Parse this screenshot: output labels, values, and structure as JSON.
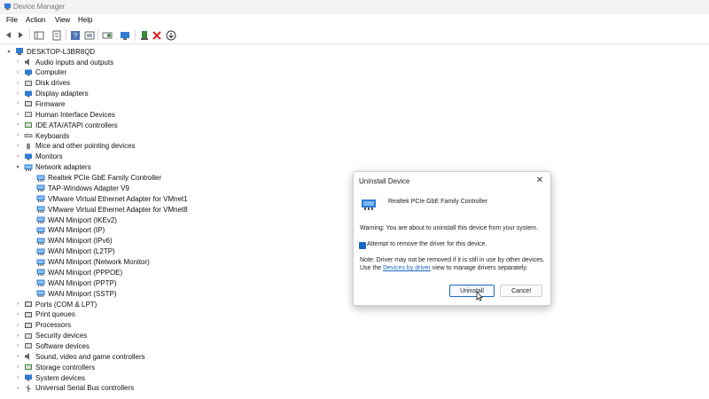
{
  "window": {
    "title": "Device Manager",
    "icon": "device-manager-icon"
  },
  "menu": [
    "File",
    "Action",
    "View",
    "Help"
  ],
  "toolbar": [
    "back-icon",
    "forward-icon",
    "show-hide-tree-icon",
    "properties-icon",
    "help-icon",
    "view-resources-icon",
    "scan-hardware-icon",
    "update-driver-icon",
    "add-legacy-icon",
    "disable-device-icon",
    "uninstall-device-icon",
    "download-icon"
  ],
  "tree": {
    "root": {
      "label": "DESKTOP-L3BR8QD",
      "icon": "computer-icon",
      "expanded": true
    },
    "categories": [
      {
        "label": "Audio inputs and outputs",
        "icon": "speaker-icon",
        "color": "#555555"
      },
      {
        "label": "Computer",
        "icon": "monitor-icon",
        "color": "#2f7bd6"
      },
      {
        "label": "Disk drives",
        "icon": "disk-drive-icon",
        "color": "#666666"
      },
      {
        "label": "Display adapters",
        "icon": "display-adapter-icon",
        "color": "#2f7bd6"
      },
      {
        "label": "Firmware",
        "icon": "firmware-icon",
        "color": "#555555"
      },
      {
        "label": "Human Interface Devices",
        "icon": "hid-icon",
        "color": "#777777"
      },
      {
        "label": "IDE ATA/ATAPI controllers",
        "icon": "ide-controller-icon",
        "color": "#3a8a3a"
      },
      {
        "label": "Keyboards",
        "icon": "keyboard-icon",
        "color": "#666666"
      },
      {
        "label": "Mice and other pointing devices",
        "icon": "mouse-icon",
        "color": "#666666"
      },
      {
        "label": "Monitors",
        "icon": "monitor-icon",
        "color": "#2f7bd6"
      },
      {
        "label": "Network adapters",
        "icon": "network-adapter-icon",
        "color": "#2f7bd6",
        "expanded": true,
        "children": [
          "Realtek PCIe GbE Family Controller",
          "TAP-Windows Adapter V9",
          "VMware Virtual Ethernet Adapter for VMnet1",
          "VMware Virtual Ethernet Adapter for VMnet8",
          "WAN Miniport (IKEv2)",
          "WAN Miniport (IP)",
          "WAN Miniport (IPv6)",
          "WAN Miniport (L2TP)",
          "WAN Miniport (Network Monitor)",
          "WAN Miniport (PPPOE)",
          "WAN Miniport (PPTP)",
          "WAN Miniport (SSTP)"
        ]
      },
      {
        "label": "Ports (COM & LPT)",
        "icon": "port-icon",
        "color": "#555555"
      },
      {
        "label": "Print queues",
        "icon": "printer-icon",
        "color": "#555555"
      },
      {
        "label": "Processors",
        "icon": "processor-icon",
        "color": "#555555"
      },
      {
        "label": "Security devices",
        "icon": "security-device-icon",
        "color": "#666666"
      },
      {
        "label": "Software devices",
        "icon": "software-device-icon",
        "color": "#666666"
      },
      {
        "label": "Sound, video and game controllers",
        "icon": "sound-icon",
        "color": "#666666"
      },
      {
        "label": "Storage controllers",
        "icon": "storage-controller-icon",
        "color": "#3a8a3a"
      },
      {
        "label": "System devices",
        "icon": "system-device-icon",
        "color": "#2f7bd6"
      },
      {
        "label": "Universal Serial Bus controllers",
        "icon": "usb-icon",
        "color": "#555555"
      }
    ]
  },
  "dialog": {
    "title": "Uninstall Device",
    "close": "✕",
    "device_name": "Realtek PCIe GbE Family Controller",
    "warning": "Warning: You are about to uninstall this device from your system.",
    "checkbox_label": "Attempt to remove the driver for this device.",
    "checkbox_checked": true,
    "note_before": "Note: Driver may not be removed if it is still in use by other devices. Use the ",
    "note_link": "Devices by driver",
    "note_after": " view to manage drivers separately.",
    "uninstall_label": "Uninstall",
    "cancel_label": "Cancel"
  },
  "colors": {
    "accent": "#1a66c4",
    "adapter": "#2f7bd6"
  }
}
